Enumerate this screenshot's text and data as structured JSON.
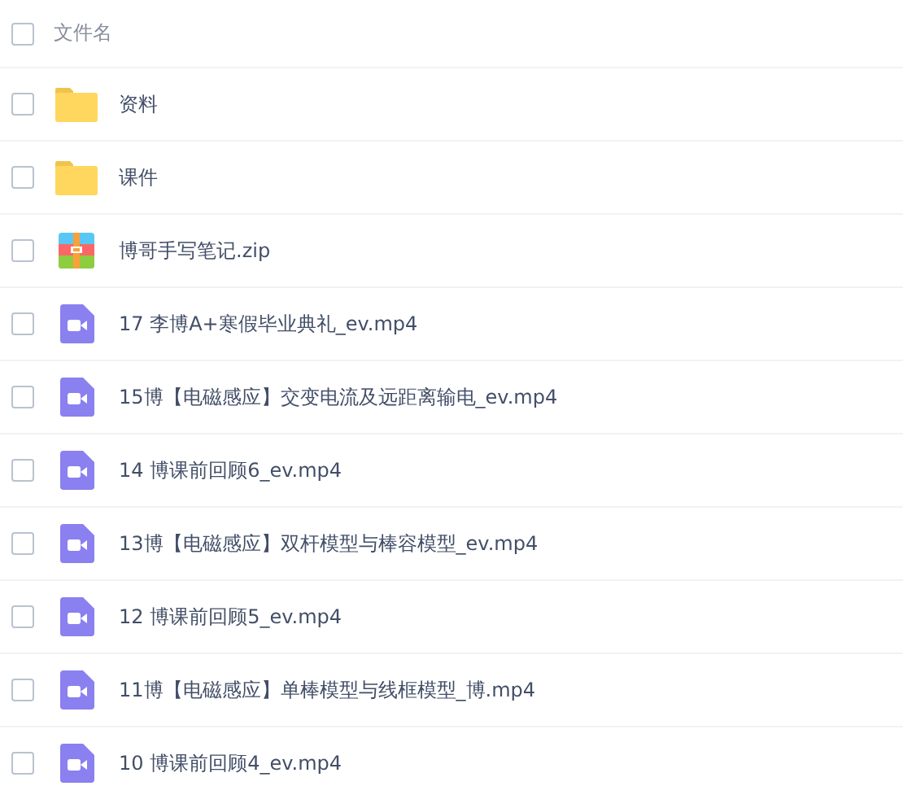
{
  "header": {
    "label": "文件名",
    "checked": false
  },
  "files": [
    {
      "name": "资料",
      "kind": "folder",
      "checked": false
    },
    {
      "name": "课件",
      "kind": "folder",
      "checked": false
    },
    {
      "name": "博哥手写笔记.zip",
      "kind": "zip",
      "checked": false
    },
    {
      "name": "17 李博A+寒假毕业典礼_ev.mp4",
      "kind": "video",
      "checked": false
    },
    {
      "name": "15博【电磁感应】交变电流及远距离输电_ev.mp4",
      "kind": "video",
      "checked": false
    },
    {
      "name": "14 博课前回顾6_ev.mp4",
      "kind": "video",
      "checked": false
    },
    {
      "name": "13博【电磁感应】双杆模型与棒容模型_ev.mp4",
      "kind": "video",
      "checked": false
    },
    {
      "name": "12 博课前回顾5_ev.mp4",
      "kind": "video",
      "checked": false
    },
    {
      "name": "11博【电磁感应】单棒模型与线框模型_博.mp4",
      "kind": "video",
      "checked": false
    },
    {
      "name": "10 博课前回顾4_ev.mp4",
      "kind": "video",
      "checked": false
    }
  ]
}
